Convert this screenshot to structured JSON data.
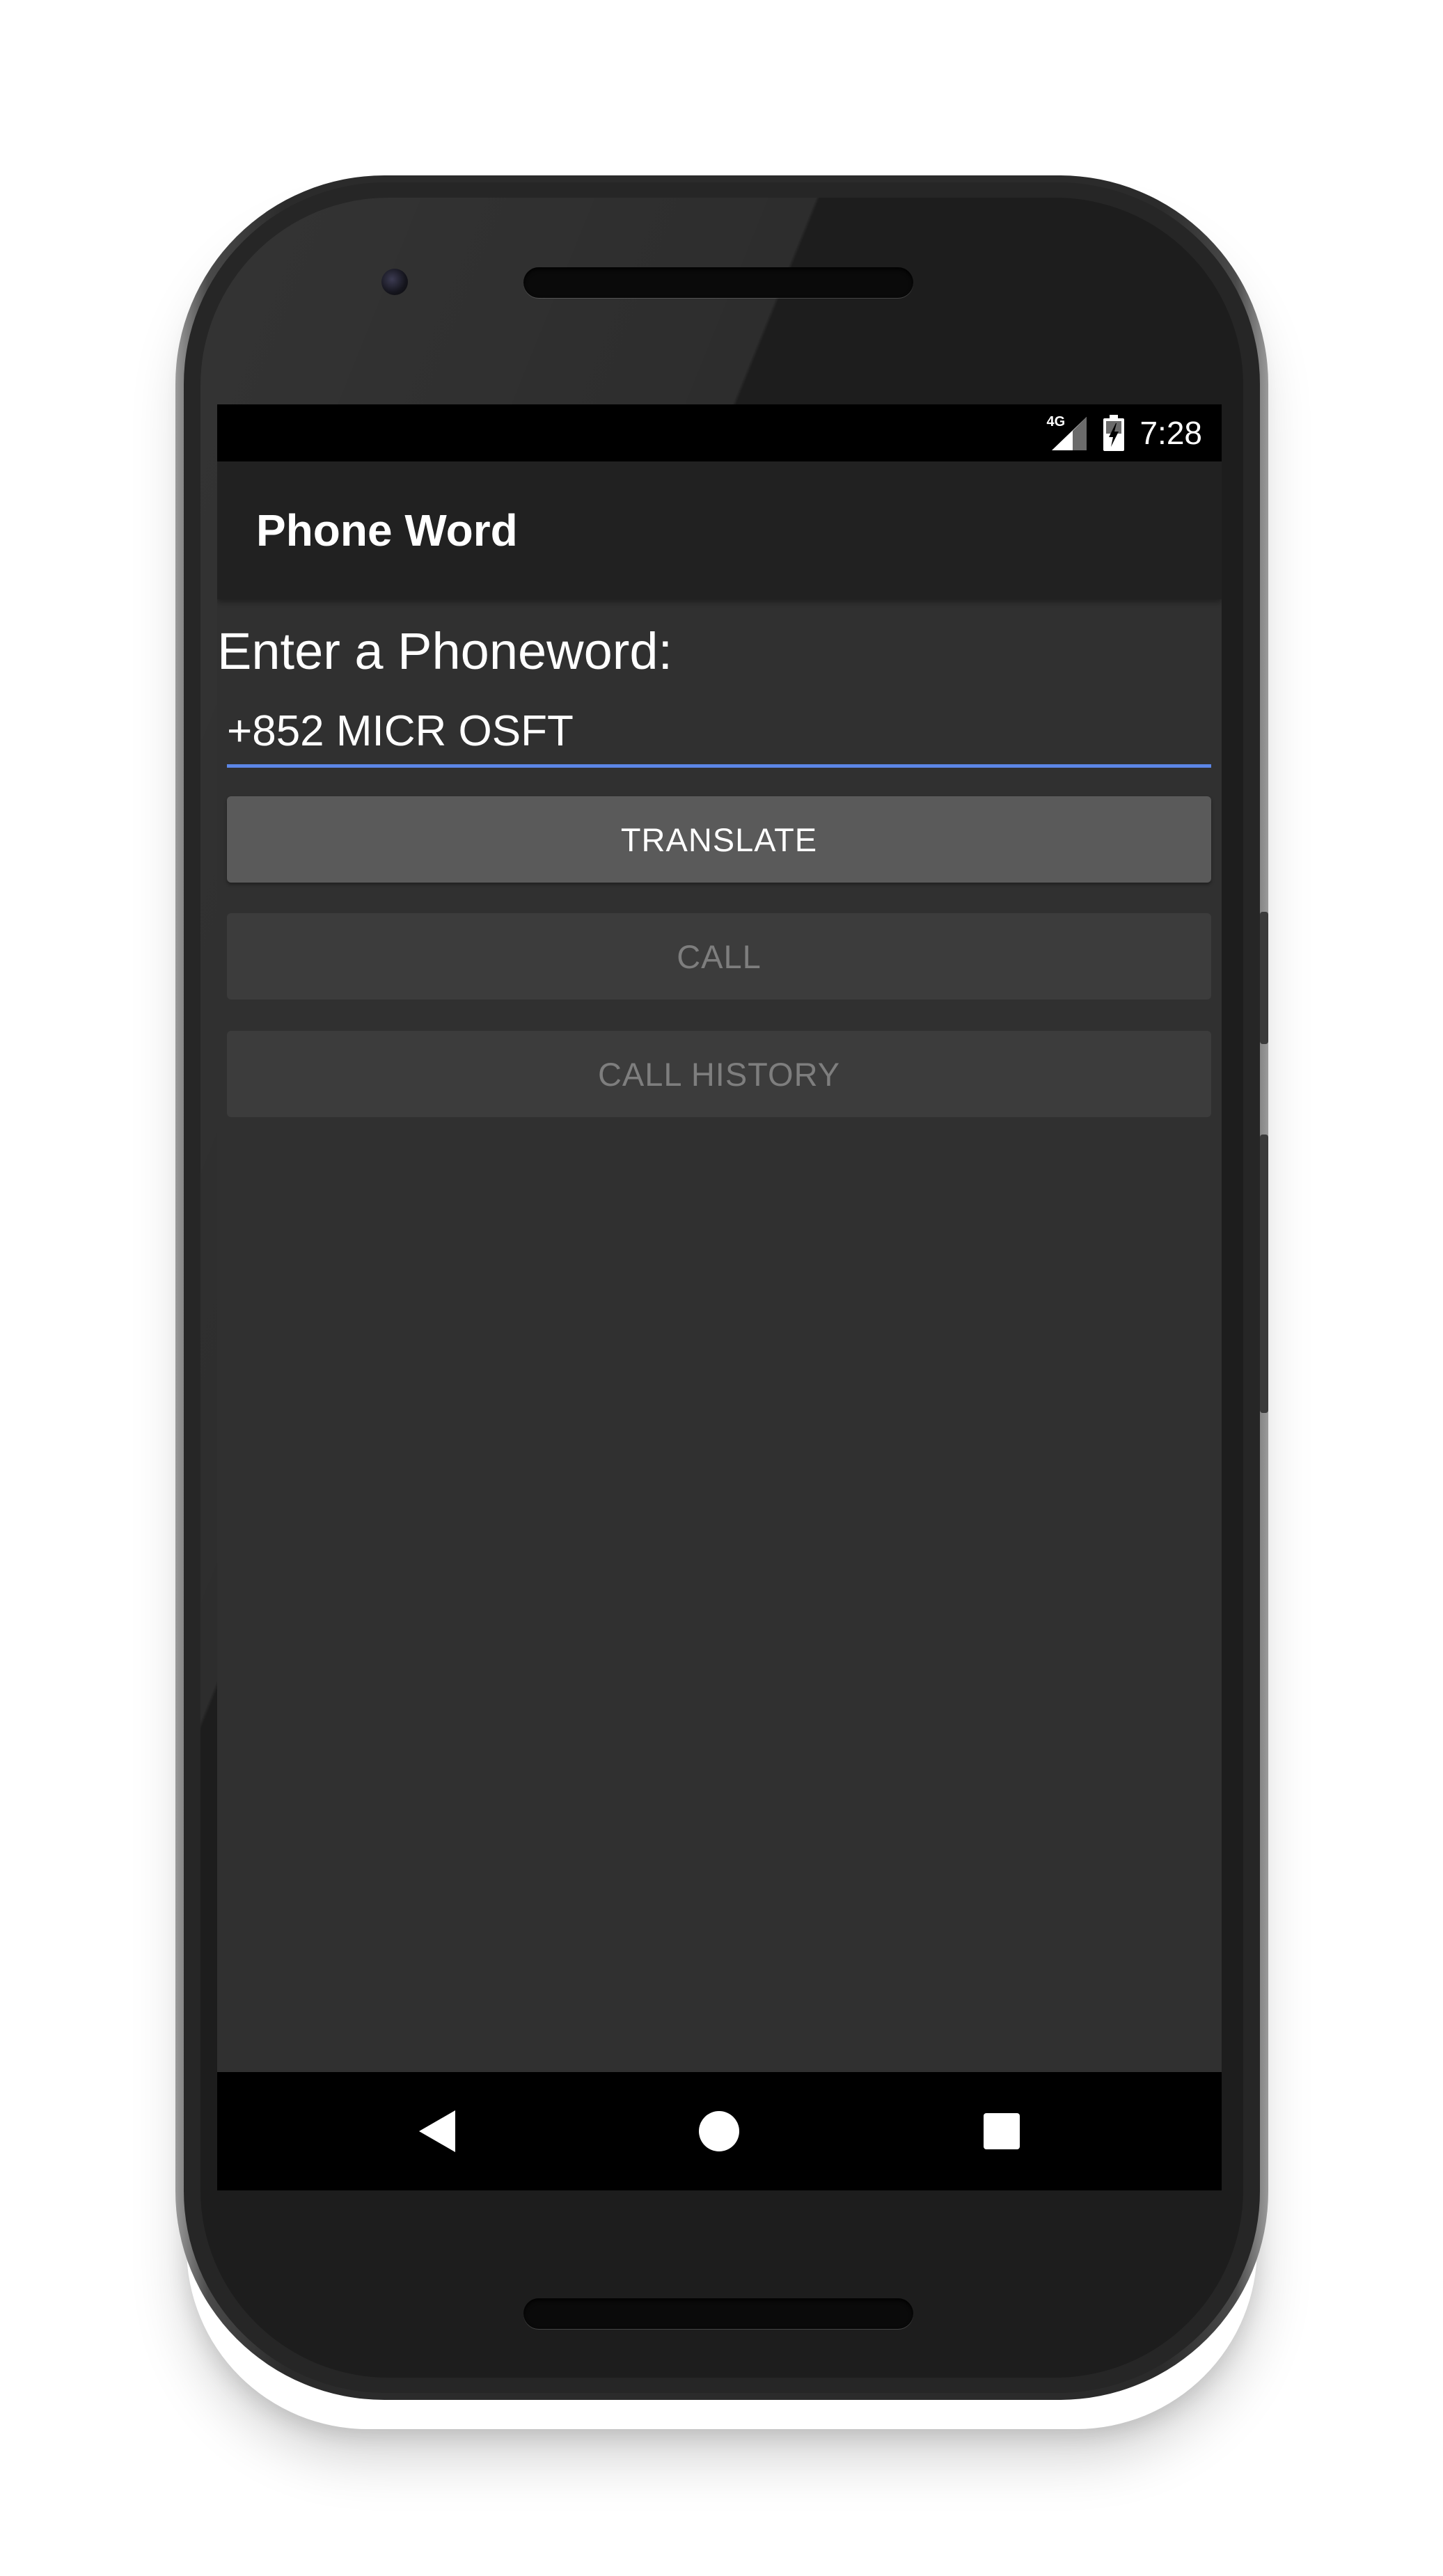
{
  "status_bar": {
    "network_type": "4G",
    "time": "7:28",
    "icons": [
      "signal-icon",
      "battery-charging-icon"
    ]
  },
  "app_bar": {
    "title": "Phone Word"
  },
  "main": {
    "prompt_label": "Enter a Phoneword:",
    "phone_input": {
      "value": "+852 MICR OSFT",
      "underline_color": "#5c86e6"
    },
    "buttons": {
      "translate": {
        "label": "TRANSLATE",
        "enabled": true
      },
      "call": {
        "label": "CALL",
        "enabled": false
      },
      "call_history": {
        "label": "CALL HISTORY",
        "enabled": false
      }
    }
  },
  "nav_bar": {
    "icons": [
      "back-icon",
      "home-icon",
      "recents-icon"
    ]
  },
  "colors": {
    "screen_background": "#303030",
    "app_bar_background": "#212121",
    "accent": "#5c86e6"
  }
}
